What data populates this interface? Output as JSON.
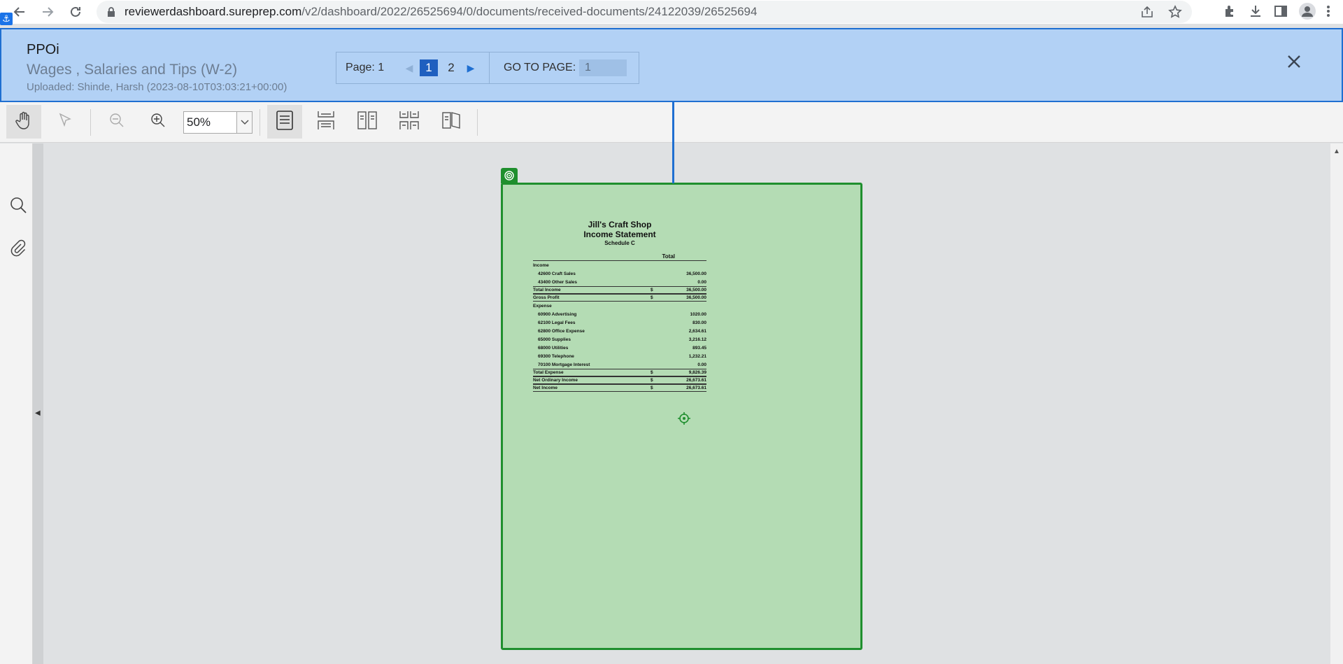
{
  "browser": {
    "url_domain": "reviewerdashboard.sureprep.com",
    "url_path": "/v2/dashboard/2022/26525694/0/documents/received-documents/24122039/26525694"
  },
  "info_panel": {
    "title": "PPOi",
    "subtitle": "Wages , Salaries and Tips (W-2)",
    "uploaded": "Uploaded: Shinde, Harsh (2023-08-10T03:03:21+00:00)",
    "page_label": "Page: 1",
    "pages": [
      "1",
      "2"
    ],
    "goto_label": "GO TO PAGE:",
    "goto_value": "1"
  },
  "toolbar": {
    "zoom_value": "50%"
  },
  "statement": {
    "company": "Jill's Craft Shop",
    "title": "Income Statement",
    "schedule": "Schedule C",
    "column_header": "Total",
    "rows": [
      {
        "label": "Income",
        "currency": "",
        "value": "",
        "style": "header"
      },
      {
        "label": "42600 Craft Sales",
        "currency": "",
        "value": "36,500.00",
        "style": "indent"
      },
      {
        "label": "43400 Other Sales",
        "currency": "",
        "value": "0.00",
        "style": "indent"
      },
      {
        "label": "Total Income",
        "currency": "$",
        "value": "36,500.00",
        "style": "total"
      },
      {
        "label": "Gross Profit",
        "currency": "$",
        "value": "36,500.00",
        "style": "total"
      },
      {
        "label": "Expense",
        "currency": "",
        "value": "",
        "style": "header"
      },
      {
        "label": "60900 Advertising",
        "currency": "",
        "value": "1020.00",
        "style": "indent"
      },
      {
        "label": "62100 Legal Fees",
        "currency": "",
        "value": "830.00",
        "style": "indent"
      },
      {
        "label": "62800 Office Expense",
        "currency": "",
        "value": "2,634.61",
        "style": "indent"
      },
      {
        "label": "65000 Supplies",
        "currency": "",
        "value": "3,216.12",
        "style": "indent"
      },
      {
        "label": "68000 Utilities",
        "currency": "",
        "value": "893.45",
        "style": "indent"
      },
      {
        "label": "69300 Telephone",
        "currency": "",
        "value": "1,232.21",
        "style": "indent"
      },
      {
        "label": "70100 Mortgage Interest",
        "currency": "",
        "value": "0.00",
        "style": "indent"
      },
      {
        "label": "Total Expense",
        "currency": "$",
        "value": "9,826.39",
        "style": "total"
      },
      {
        "label": "Net Ordinary Income",
        "currency": "$",
        "value": "26,673.61",
        "style": "total"
      },
      {
        "label": "Net Income",
        "currency": "$",
        "value": "26,673.61",
        "style": "total"
      }
    ]
  },
  "colors": {
    "panel_bg": "#b2d1f5",
    "panel_border": "#1f6fd1",
    "doc_bg": "#b4dcb4",
    "doc_border": "#1f8f2e"
  },
  "icons": [
    "back-icon",
    "forward-icon",
    "reload-icon",
    "lock-icon",
    "share-icon",
    "star-icon",
    "extensions-icon",
    "download-icon",
    "sidepanel-icon",
    "profile-icon",
    "anchor-icon",
    "close-icon",
    "hand-icon",
    "select-icon",
    "zoom-out-icon",
    "zoom-in-icon",
    "single-page-icon",
    "continuous-icon",
    "two-page-icon",
    "two-page-continuous-icon",
    "book-view-icon",
    "search-icon",
    "attachment-icon",
    "target-icon"
  ]
}
